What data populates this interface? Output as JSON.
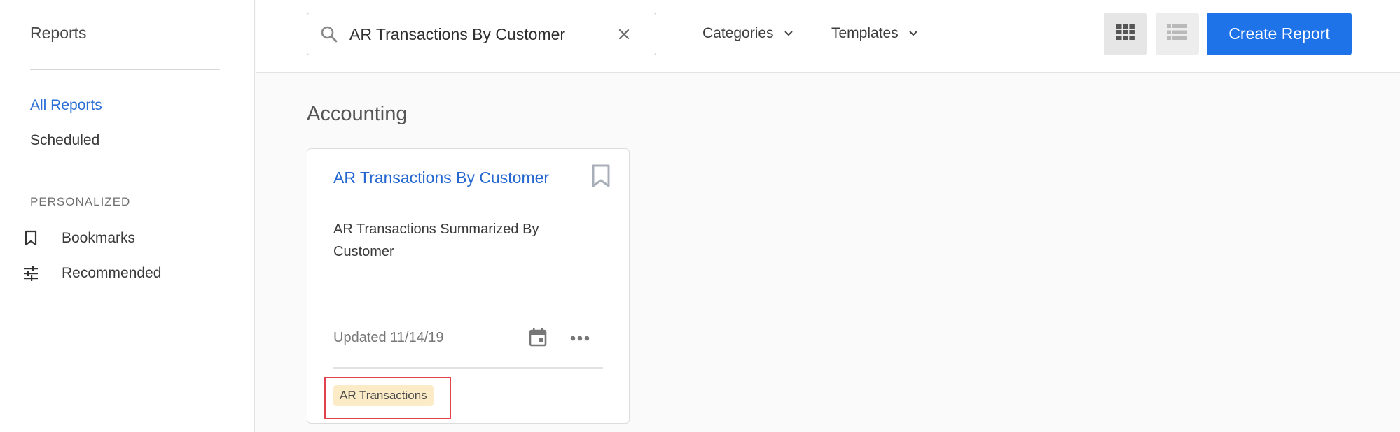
{
  "sidebar": {
    "title": "Reports",
    "links": [
      {
        "label": "All Reports",
        "active": true
      },
      {
        "label": "Scheduled",
        "active": false
      }
    ],
    "section_label": "PERSONALIZED",
    "items": [
      {
        "label": "Bookmarks",
        "icon": "bookmark-icon"
      },
      {
        "label": "Recommended",
        "icon": "tune-icon"
      }
    ]
  },
  "header": {
    "search": {
      "value": "AR Transactions By Customer",
      "icon": "search-icon"
    },
    "dropdowns": [
      {
        "label": "Categories"
      },
      {
        "label": "Templates"
      }
    ],
    "view_toggle": [
      "grid-view-icon",
      "list-view-icon"
    ],
    "create_button": "Create Report"
  },
  "main": {
    "section_title": "Accounting",
    "cards": [
      {
        "title": "AR Transactions By Customer",
        "description": "AR Transactions Summarized By Customer",
        "updated": "Updated 11/14/19",
        "tag": "AR Transactions"
      }
    ]
  },
  "colors": {
    "accent": "#1f73e8",
    "link": "#2467d0",
    "tag_bg": "#fbebc6",
    "highlight": "#e0434b"
  }
}
